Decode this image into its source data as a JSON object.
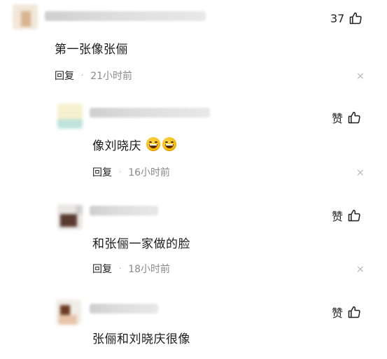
{
  "comments": [
    {
      "text": "第一张像张俪",
      "emojis": [],
      "reply_label": "回复",
      "separator": "·",
      "time": "21小时前",
      "like_text": "37",
      "close_glyph": "×"
    },
    {
      "text": "像刘晓庆",
      "emojis": [
        "grinning-face-icon",
        "grinning-face-icon"
      ],
      "reply_label": "回复",
      "separator": "·",
      "time": "16小时前",
      "like_text": "赞",
      "close_glyph": "×"
    },
    {
      "text": "和张俪一家做的脸",
      "emojis": [],
      "reply_label": "回复",
      "separator": "·",
      "time": "18小时前",
      "like_text": "赞",
      "close_glyph": "×"
    },
    {
      "text": "张俪和刘晓庆很像",
      "emojis": [],
      "like_text": "赞"
    }
  ],
  "colors": {
    "text": "#1a1a1a",
    "meta": "#8a8a8a",
    "close": "#b5b5b5",
    "emoji": "#f6b500"
  }
}
